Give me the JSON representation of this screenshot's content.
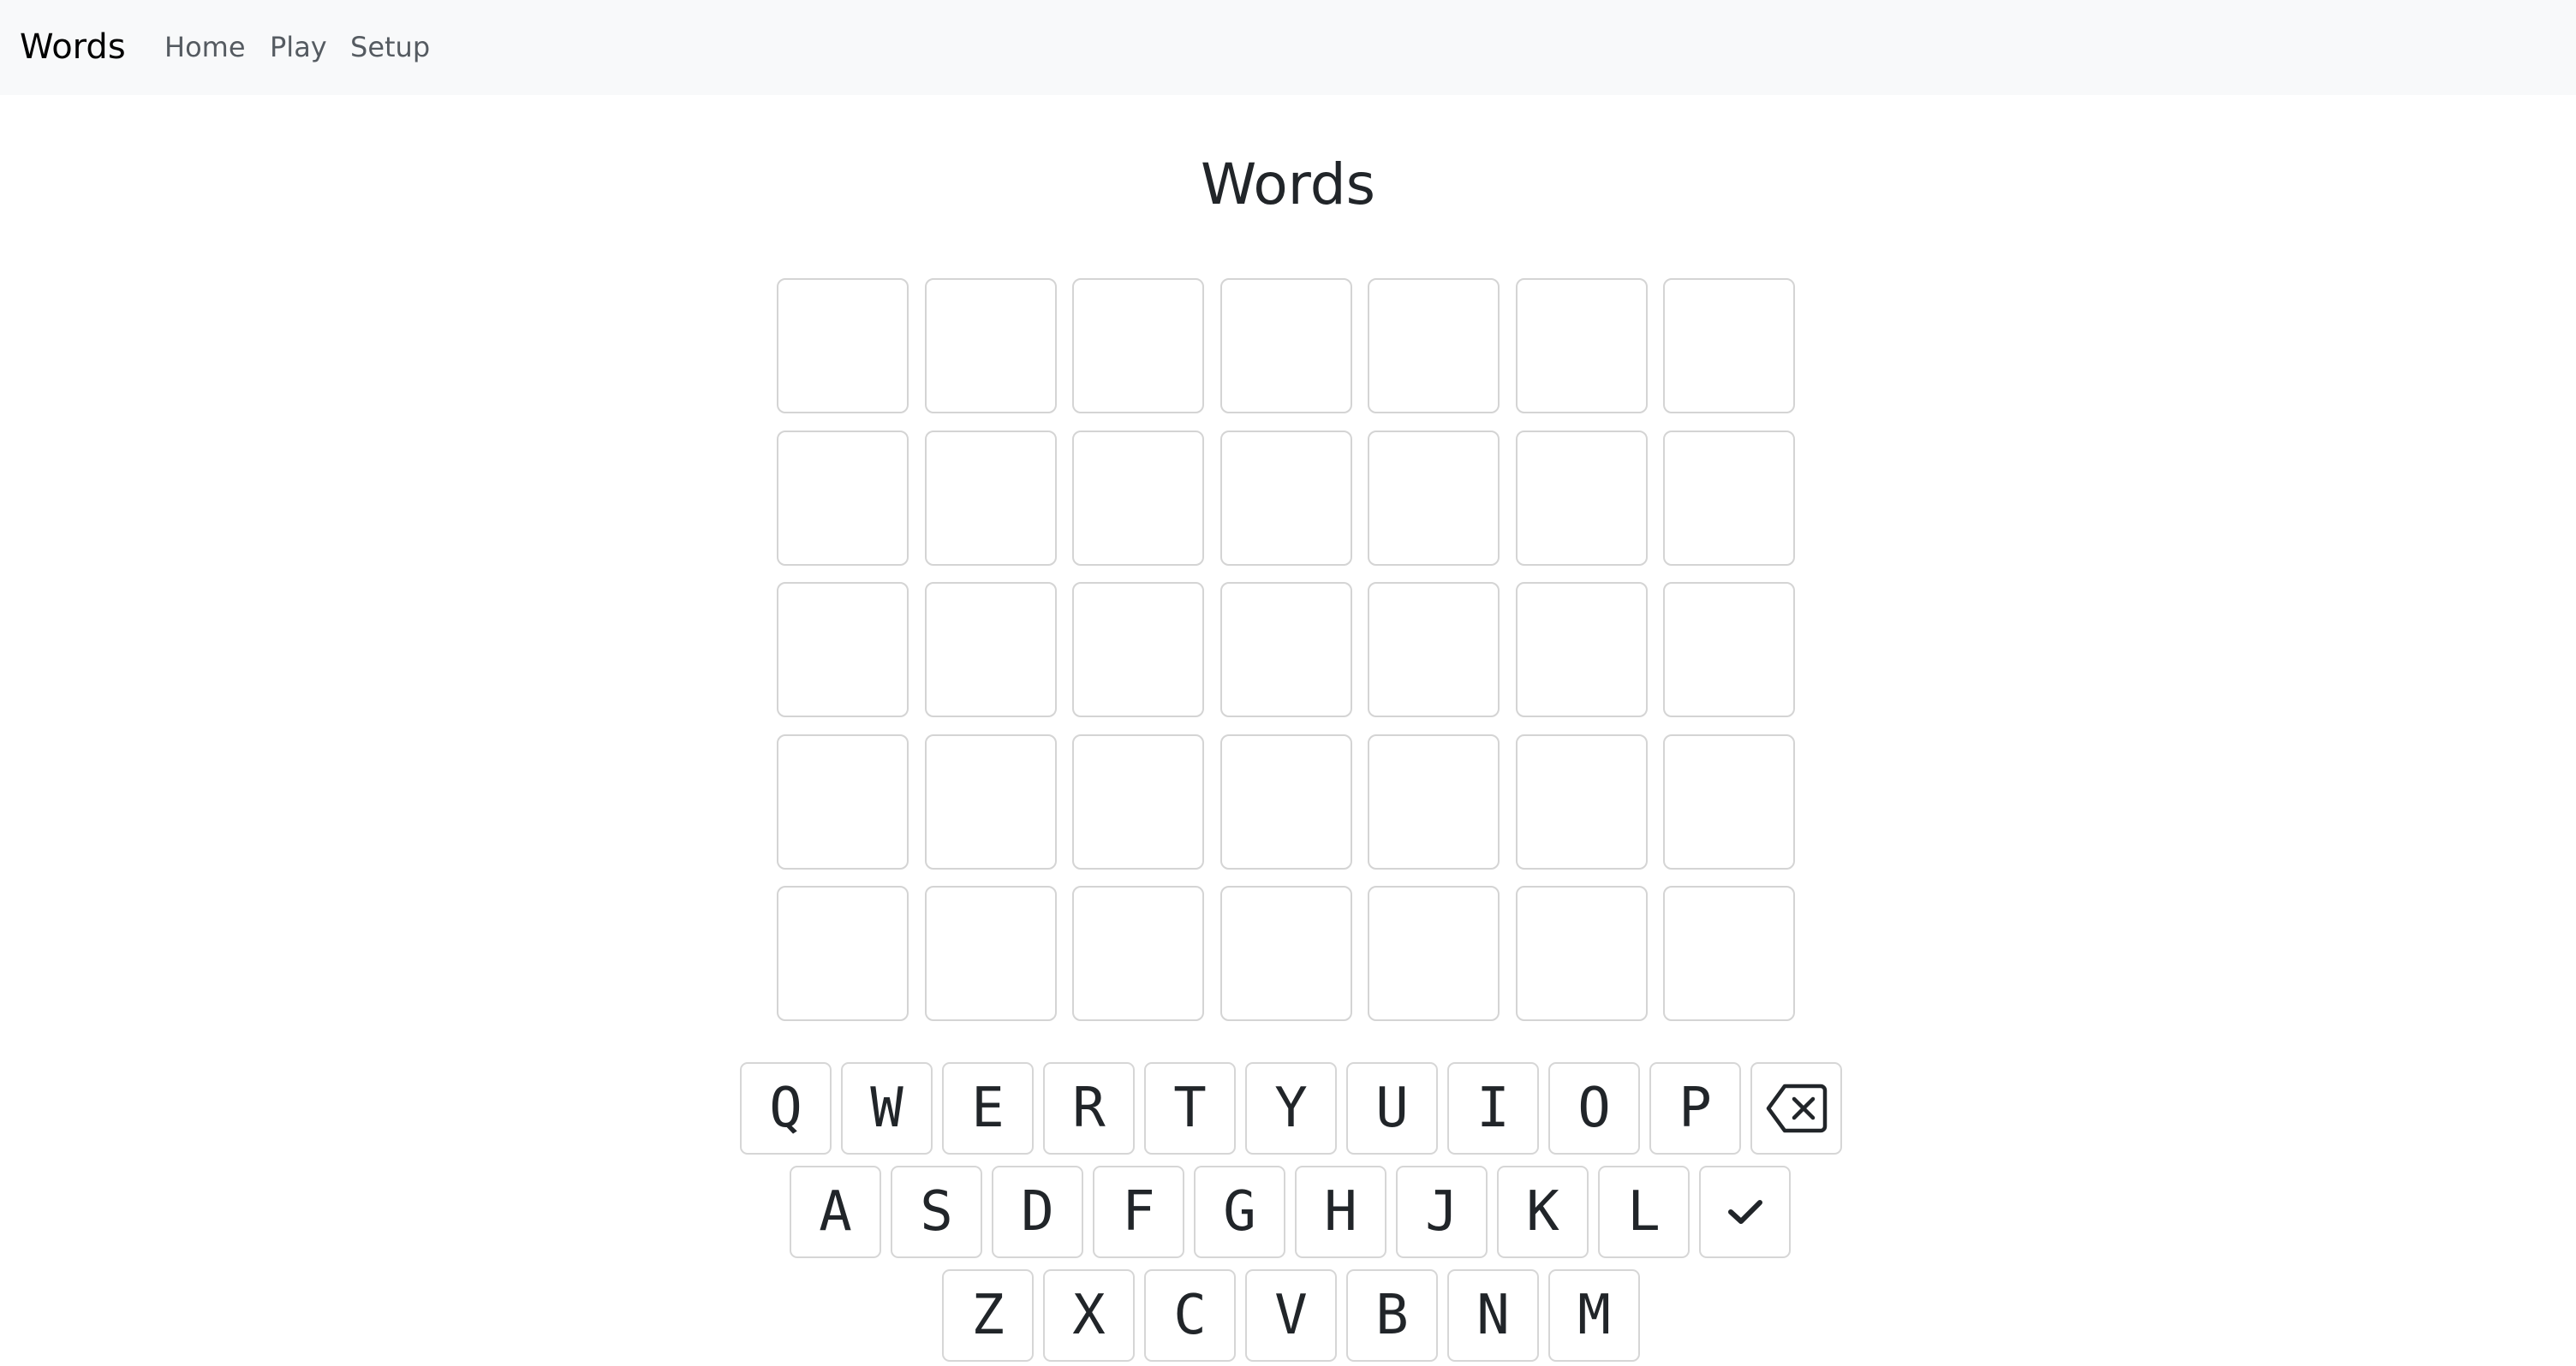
{
  "navbar": {
    "brand": "Words",
    "links": [
      {
        "label": "Home"
      },
      {
        "label": "Play"
      },
      {
        "label": "Setup"
      }
    ]
  },
  "main": {
    "title": "Words"
  },
  "board": {
    "rows": 5,
    "columns": 7,
    "letters": [
      [
        "",
        "",
        "",
        "",
        "",
        "",
        ""
      ],
      [
        "",
        "",
        "",
        "",
        "",
        "",
        ""
      ],
      [
        "",
        "",
        "",
        "",
        "",
        "",
        ""
      ],
      [
        "",
        "",
        "",
        "",
        "",
        "",
        ""
      ],
      [
        "",
        "",
        "",
        "",
        "",
        "",
        ""
      ]
    ]
  },
  "keyboard": {
    "row1": [
      "Q",
      "W",
      "E",
      "R",
      "T",
      "Y",
      "U",
      "I",
      "O",
      "P"
    ],
    "row2": [
      "A",
      "S",
      "D",
      "F",
      "G",
      "H",
      "J",
      "K",
      "L"
    ],
    "row3": [
      "Z",
      "X",
      "C",
      "V",
      "B",
      "N",
      "M"
    ],
    "backspace_icon": "backspace-icon",
    "enter_icon": "check-icon"
  }
}
